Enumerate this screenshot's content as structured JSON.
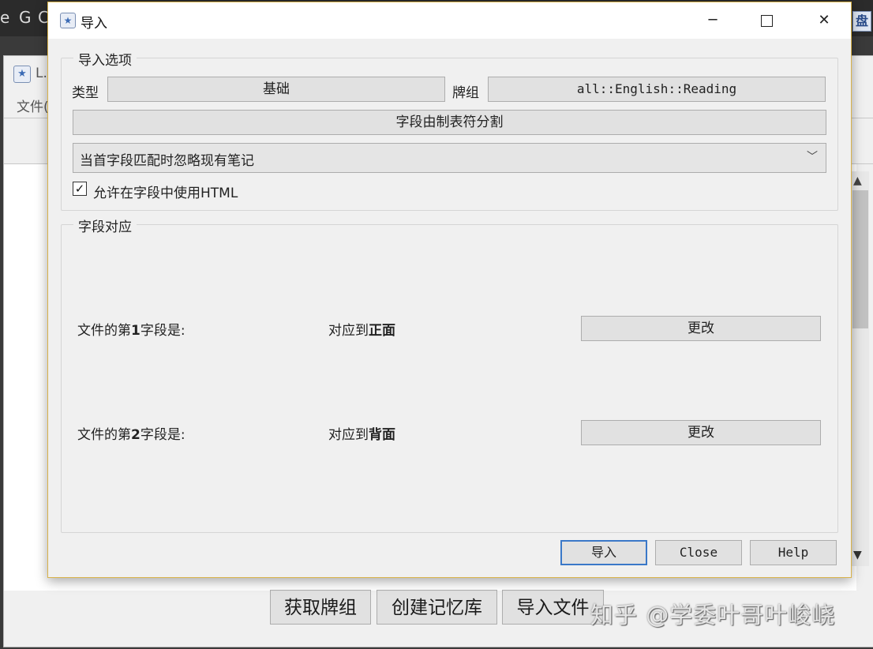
{
  "background": {
    "taskbar_glyphs": [
      "e",
      "G",
      "C"
    ],
    "taskbar_right_icon": "盘",
    "main_window": {
      "title": "L.",
      "menu_file": "文件(",
      "buttons": {
        "get_decks": "获取牌组",
        "create_profile": "创建记忆库",
        "import_file": "导入文件"
      }
    },
    "watermark": "知乎 @学委叶哥叶峻峣"
  },
  "dialog": {
    "title": "导入",
    "import_options": {
      "legend": "导入选项",
      "type_label": "类型",
      "type_value": "基础",
      "deck_label": "牌组",
      "deck_value": "all::English::Reading",
      "separator_button": "字段由制表符分割",
      "duplicate_mode": "当首字段匹配时忽略现有笔记",
      "allow_html_label": "允许在字段中使用HTML",
      "allow_html_checked": true
    },
    "field_mapping": {
      "legend": "字段对应",
      "rows": [
        {
          "source_prefix": "文件的第",
          "source_num": "1",
          "source_suffix": "字段是:",
          "maps_prefix": "对应到",
          "maps_target": "正面",
          "change": "更改"
        },
        {
          "source_prefix": "文件的第",
          "source_num": "2",
          "source_suffix": "字段是:",
          "maps_prefix": "对应到",
          "maps_target": "背面",
          "change": "更改"
        }
      ]
    },
    "buttons": {
      "import": "导入",
      "close": "Close",
      "help": "Help"
    }
  },
  "colors": {
    "dialog_border": "#d8b24a",
    "default_button_border": "#3a78c8"
  }
}
